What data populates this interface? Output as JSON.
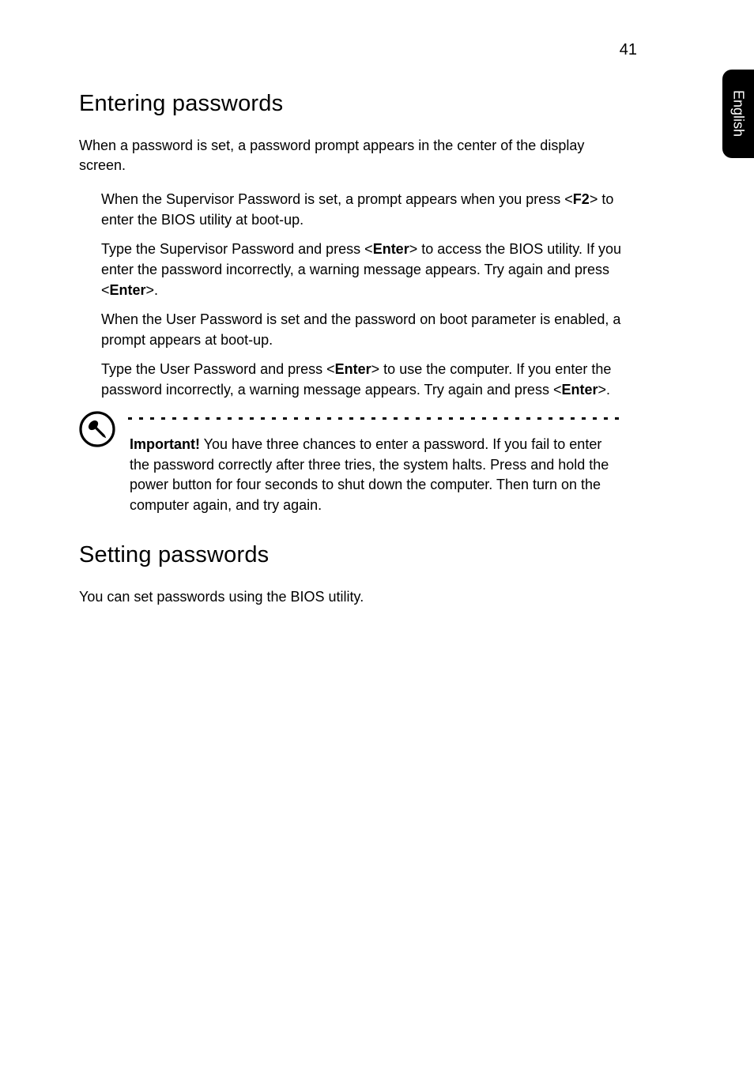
{
  "page_number": "41",
  "side_tab": "English",
  "section1": {
    "heading": "Entering passwords",
    "intro": "When a password is set, a password prompt appears in the center of the display screen.",
    "bullets": [
      {
        "pre": "When the Supervisor Password is set, a prompt appears when you press <",
        "b1": "F2",
        "post": "> to enter the BIOS utility at boot-up."
      },
      {
        "pre": "Type the Supervisor Password and press <",
        "b1": "Enter",
        "mid": "> to access the BIOS utility. If you enter the password incorrectly, a warning message appears. Try again and press <",
        "b2": "Enter",
        "post": ">."
      },
      {
        "pre": "When the User Password is set and the password on boot parameter is enabled, a prompt appears at boot-up.",
        "b1": "",
        "post": ""
      },
      {
        "pre": "Type the User Password and press <",
        "b1": "Enter",
        "mid": "> to use the computer. If you enter the password incorrectly, a warning message appears. Try again and press <",
        "b2": "Enter",
        "post": ">."
      }
    ],
    "note": {
      "label": "Important!",
      "text": " You have three chances to enter a password. If you fail to enter the password correctly after three tries, the system halts. Press and hold the power button for four seconds to shut down the computer. Then turn on the computer again, and try again."
    }
  },
  "section2": {
    "heading": "Setting passwords",
    "intro": "You can set passwords using the BIOS utility."
  }
}
